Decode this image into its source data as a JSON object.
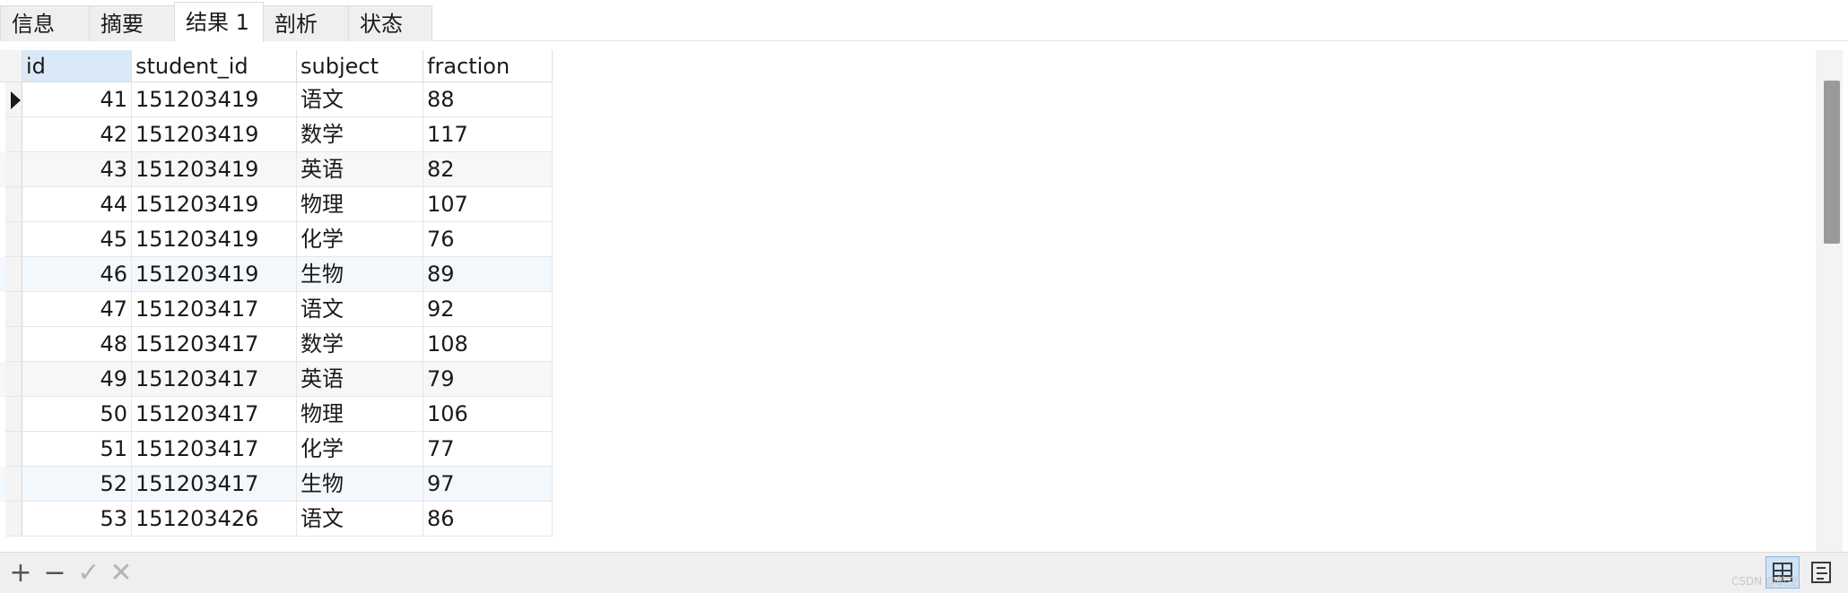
{
  "tabs": [
    {
      "label": "信息"
    },
    {
      "label": "摘要"
    },
    {
      "label": "结果 1"
    },
    {
      "label": "剖析"
    },
    {
      "label": "状态"
    }
  ],
  "grid": {
    "columns": [
      "id",
      "student_id",
      "subject",
      "fraction"
    ],
    "rows": [
      {
        "id": "41",
        "student_id": "151203419",
        "subject": "语文",
        "fraction": "88"
      },
      {
        "id": "42",
        "student_id": "151203419",
        "subject": "数学",
        "fraction": "117"
      },
      {
        "id": "43",
        "student_id": "151203419",
        "subject": "英语",
        "fraction": "82"
      },
      {
        "id": "44",
        "student_id": "151203419",
        "subject": "物理",
        "fraction": "107"
      },
      {
        "id": "45",
        "student_id": "151203419",
        "subject": "化学",
        "fraction": "76"
      },
      {
        "id": "46",
        "student_id": "151203419",
        "subject": "生物",
        "fraction": "89"
      },
      {
        "id": "47",
        "student_id": "151203417",
        "subject": "语文",
        "fraction": "92"
      },
      {
        "id": "48",
        "student_id": "151203417",
        "subject": "数学",
        "fraction": "108"
      },
      {
        "id": "49",
        "student_id": "151203417",
        "subject": "英语",
        "fraction": "79"
      },
      {
        "id": "50",
        "student_id": "151203417",
        "subject": "物理",
        "fraction": "106"
      },
      {
        "id": "51",
        "student_id": "151203417",
        "subject": "化学",
        "fraction": "77"
      },
      {
        "id": "52",
        "student_id": "151203417",
        "subject": "生物",
        "fraction": "97"
      },
      {
        "id": "53",
        "student_id": "151203426",
        "subject": "语文",
        "fraction": "86"
      }
    ]
  },
  "toolbar": {
    "add_icon": "+",
    "delete_icon": "−",
    "apply_icon": "✓",
    "cancel_icon": "✕"
  },
  "watermark": "CSDN @航空",
  "colors": {
    "selected_header": "#d9e9f8",
    "active_view_button": "#cfe3f7"
  }
}
